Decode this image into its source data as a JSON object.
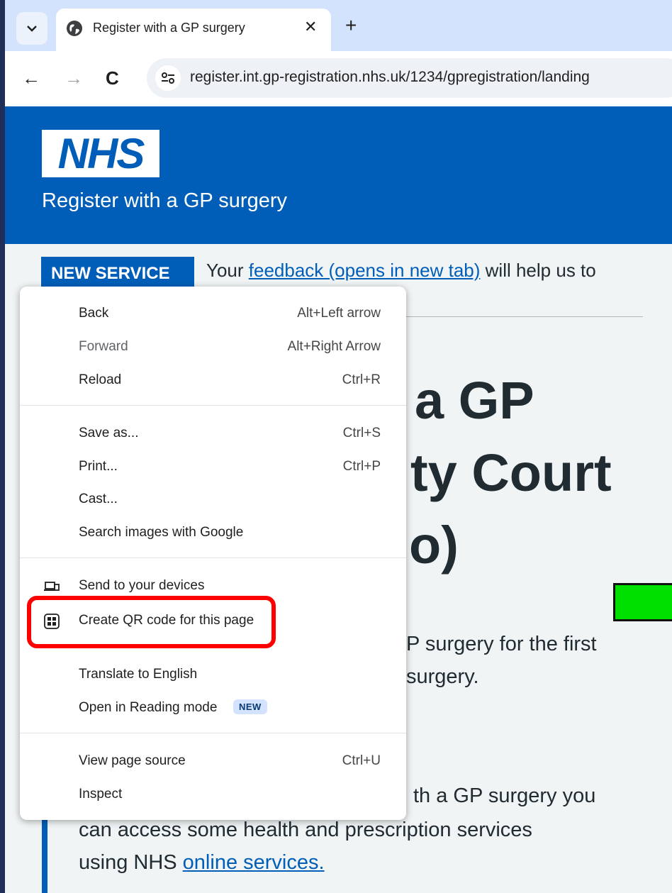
{
  "browser": {
    "tab_title": "Register with a GP surgery",
    "tab_close": "✕",
    "new_tab": "+",
    "tab_dropdown_icon": "chevron-down-icon",
    "back": "←",
    "forward": "→",
    "reload": "C",
    "url": "register.int.gp-registration.nhs.uk/1234/gpregistration/landing"
  },
  "page": {
    "logo": "NHS",
    "service_name": "Register with a GP surgery",
    "tag": "NEW SERVICE",
    "banner_prefix": "Your ",
    "banner_link": "feedback (opens in new tab)",
    "banner_suffix": " will help us to",
    "heading_lines": [
      "a GP",
      "ty Court",
      "o)"
    ],
    "body_lines": [
      "P surgery for the first",
      "surgery."
    ],
    "inset_line1": "th a GP surgery you",
    "inset_line2": "can access some health and prescription services",
    "inset_line3_prefix": "using NHS ",
    "inset_line3_link": "online services."
  },
  "context_menu": {
    "back": {
      "label": "Back",
      "shortcut": "Alt+Left arrow"
    },
    "forward": {
      "label": "Forward",
      "shortcut": "Alt+Right Arrow"
    },
    "reload": {
      "label": "Reload",
      "shortcut": "Ctrl+R"
    },
    "save_as": {
      "label": "Save as...",
      "shortcut": "Ctrl+S"
    },
    "print": {
      "label": "Print...",
      "shortcut": "Ctrl+P"
    },
    "cast": {
      "label": "Cast..."
    },
    "search_images": {
      "label": "Search images with Google"
    },
    "send_devices": {
      "label": "Send to your devices"
    },
    "create_qr": {
      "label": "Create QR code for this page"
    },
    "translate": {
      "label": "Translate to English"
    },
    "reading_mode": {
      "label": "Open in Reading mode",
      "badge": "NEW"
    },
    "view_source": {
      "label": "View page source",
      "shortcut": "Ctrl+U"
    },
    "inspect": {
      "label": "Inspect"
    }
  },
  "colors": {
    "nhs_blue": "#005eb8",
    "highlight_red": "#ff0000",
    "green_block": "#00e000"
  }
}
